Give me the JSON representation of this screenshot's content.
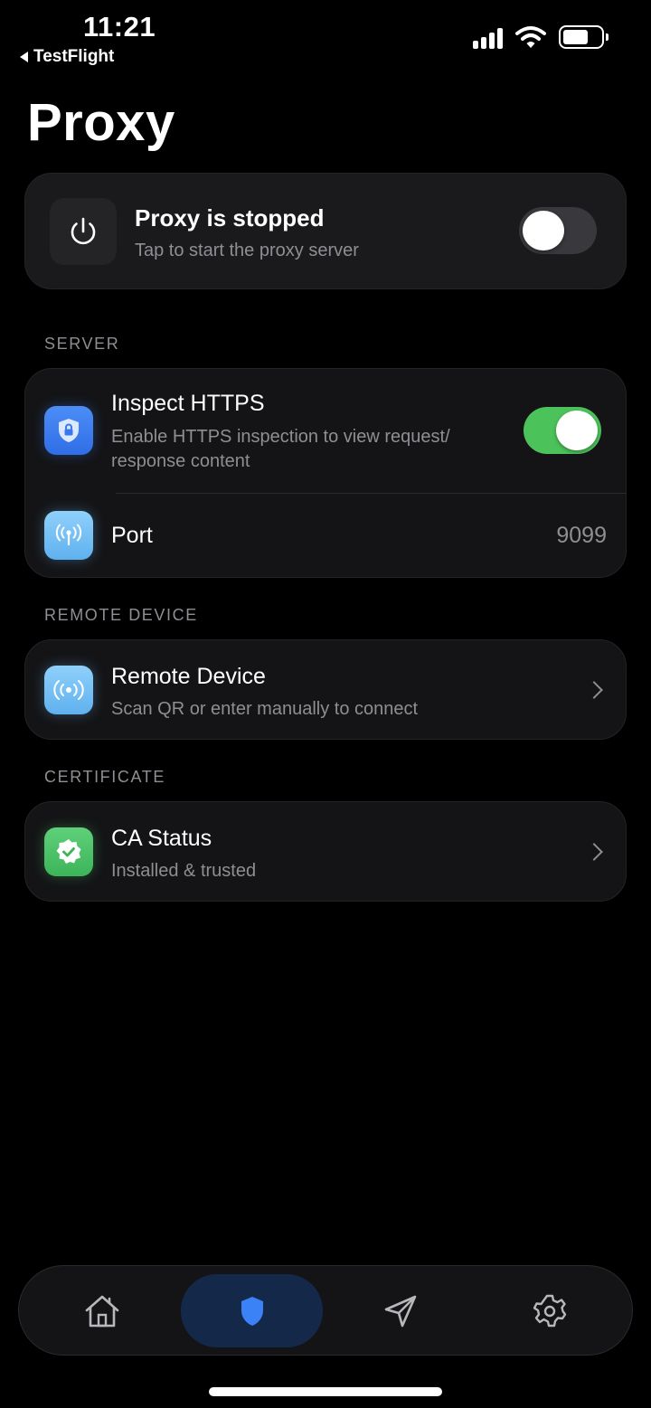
{
  "status_bar": {
    "time": "11:21",
    "back_app": "TestFlight",
    "icons": [
      "cellular-signal-icon",
      "wifi-icon",
      "battery-icon"
    ]
  },
  "page": {
    "title": "Proxy"
  },
  "proxy_card": {
    "icon": "power-icon",
    "title": "Proxy is stopped",
    "subtitle": "Tap to start the proxy server",
    "toggle_on": false
  },
  "sections": {
    "server": {
      "label": "SERVER",
      "inspect_https": {
        "icon": "lock-shield-icon",
        "title": "Inspect HTTPS",
        "subtitle_line1": "Enable HTTPS inspection to view request/",
        "subtitle_line2": "response content",
        "toggle_on": true
      },
      "port": {
        "icon": "antenna-icon",
        "title": "Port",
        "value": "9099"
      }
    },
    "remote_device": {
      "label": "REMOTE DEVICE",
      "item": {
        "icon": "broadcast-icon",
        "title": "Remote Device",
        "subtitle": "Scan QR or enter manually to connect"
      }
    },
    "certificate": {
      "label": "CERTIFICATE",
      "item": {
        "icon": "verified-badge-icon",
        "title": "CA Status",
        "subtitle": "Installed & trusted"
      }
    }
  },
  "tab_bar": {
    "tabs": [
      {
        "icon": "home-icon",
        "active": false
      },
      {
        "icon": "shield-icon",
        "active": true
      },
      {
        "icon": "send-icon",
        "active": false
      },
      {
        "icon": "gear-icon",
        "active": false
      }
    ]
  },
  "colors": {
    "background": "#000000",
    "card": "#141416",
    "accent_blue": "#3b82f6",
    "toggle_on": "#4cc25a",
    "secondary_text": "#8e8e93"
  }
}
